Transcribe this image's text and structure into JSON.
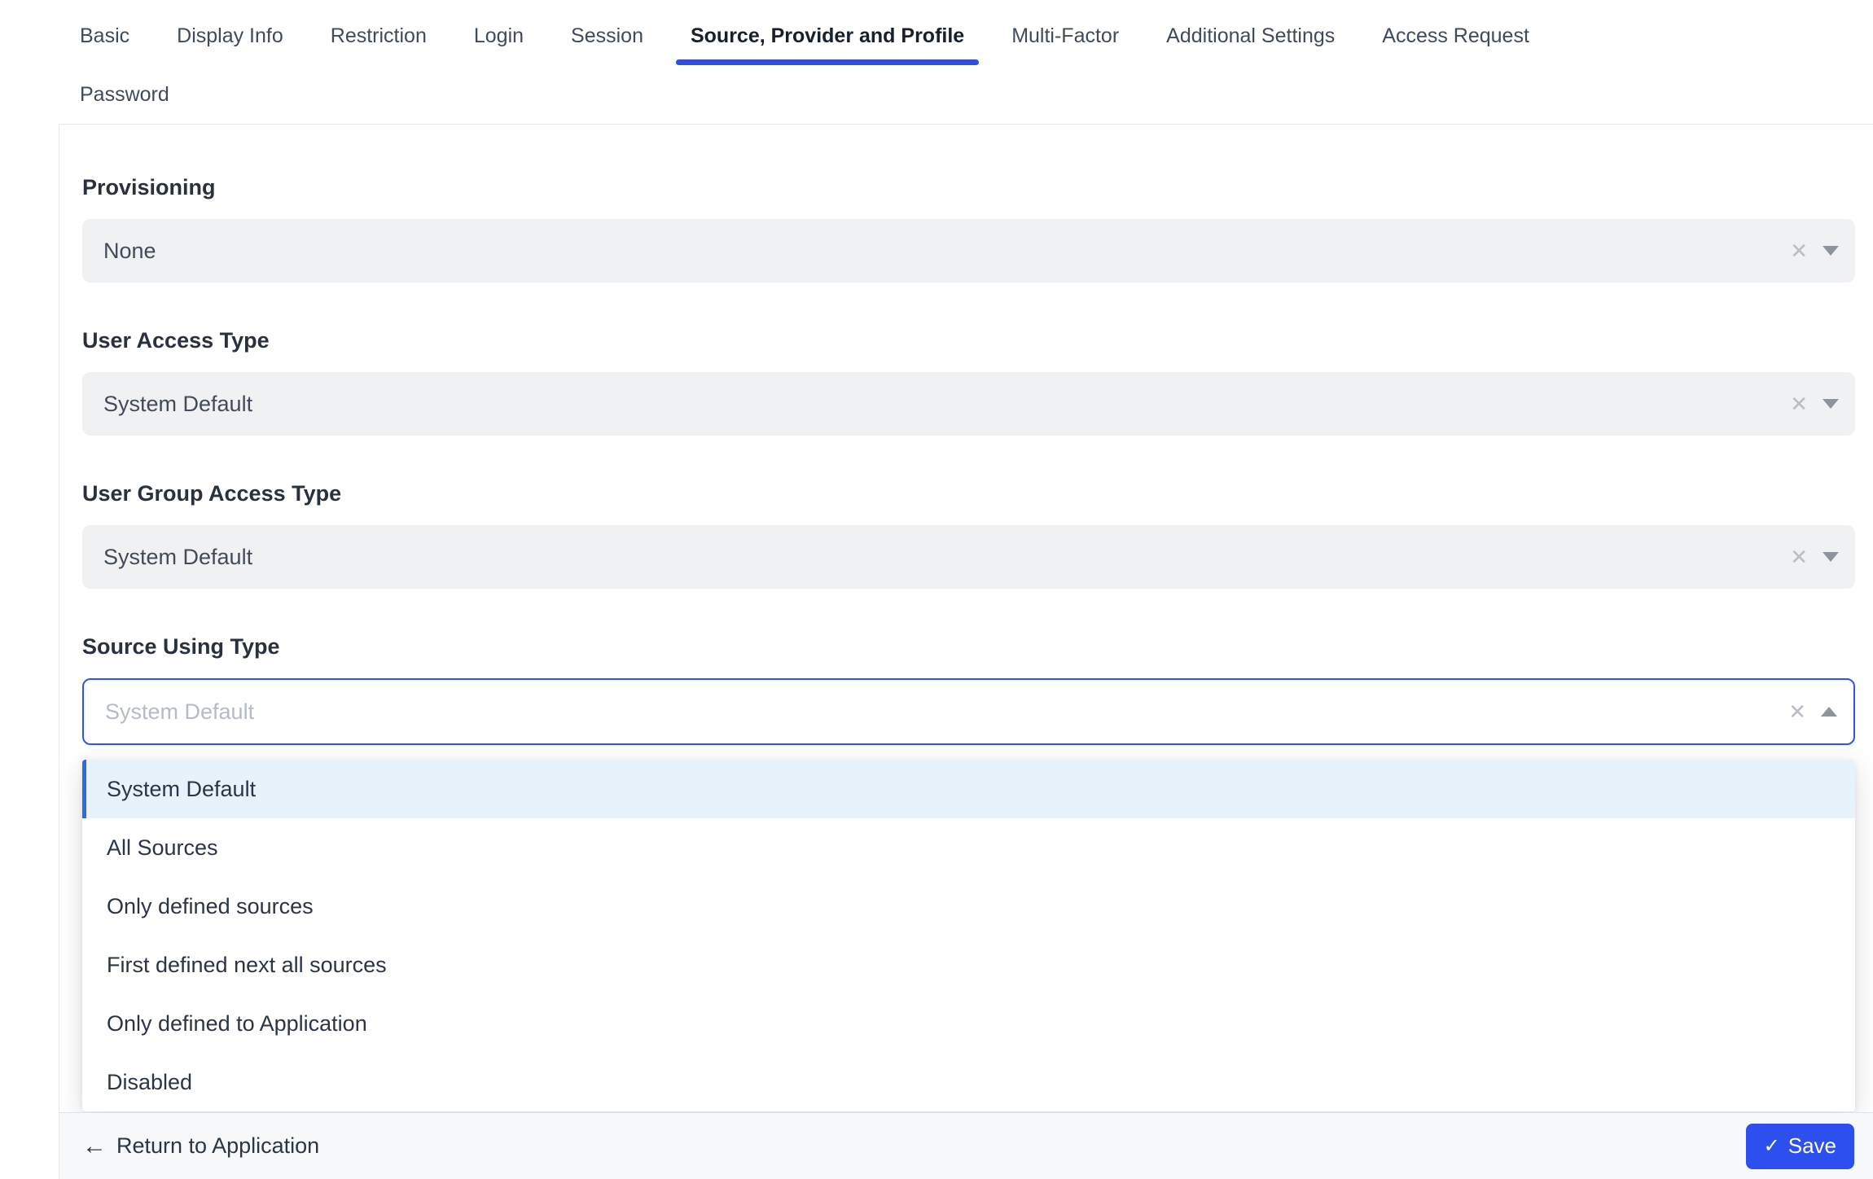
{
  "tabs": {
    "items": [
      {
        "label": "Basic"
      },
      {
        "label": "Display Info"
      },
      {
        "label": "Restriction"
      },
      {
        "label": "Login"
      },
      {
        "label": "Session"
      },
      {
        "label": "Source, Provider and Profile",
        "active": true
      },
      {
        "label": "Multi-Factor"
      },
      {
        "label": "Additional Settings"
      },
      {
        "label": "Access Request"
      },
      {
        "label": "Password"
      }
    ]
  },
  "form": {
    "provisioning": {
      "label": "Provisioning",
      "value": "None"
    },
    "user_access_type": {
      "label": "User Access Type",
      "value": "System Default"
    },
    "user_group_access_type": {
      "label": "User Group Access Type",
      "value": "System Default"
    },
    "source_using_type": {
      "label": "Source Using Type",
      "placeholder": "System Default"
    }
  },
  "dropdown": {
    "options": [
      {
        "label": "System Default",
        "selected": true
      },
      {
        "label": "All Sources"
      },
      {
        "label": "Only defined sources"
      },
      {
        "label": "First defined next all sources"
      },
      {
        "label": "Only defined to Application"
      },
      {
        "label": "Disabled"
      }
    ]
  },
  "footer": {
    "return_label": "Return to Application",
    "save_label": "Save"
  },
  "icons": {
    "clear": "✕",
    "back_arrow": "←",
    "check": "✓"
  },
  "colors": {
    "accent": "#2b4eea",
    "field_bg": "#f0f1f3",
    "selected_option_bg": "#e8f2fb",
    "save_button_bg": "#2c4fee"
  }
}
